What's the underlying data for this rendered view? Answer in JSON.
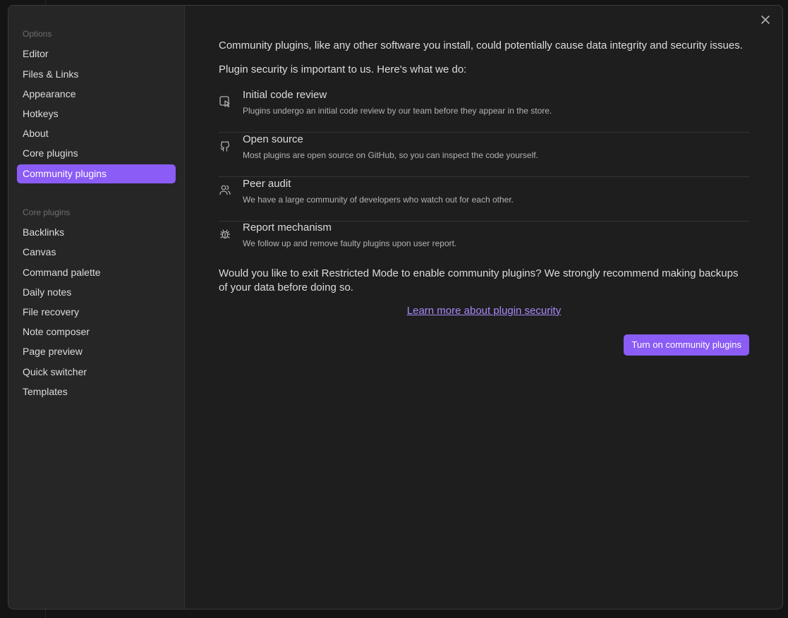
{
  "sidebar": {
    "options_heading": "Options",
    "options_items": [
      {
        "label": "Editor"
      },
      {
        "label": "Files & Links"
      },
      {
        "label": "Appearance"
      },
      {
        "label": "Hotkeys"
      },
      {
        "label": "About"
      },
      {
        "label": "Core plugins"
      },
      {
        "label": "Community plugins",
        "active": true
      }
    ],
    "core_heading": "Core plugins",
    "core_items": [
      {
        "label": "Backlinks"
      },
      {
        "label": "Canvas"
      },
      {
        "label": "Command palette"
      },
      {
        "label": "Daily notes"
      },
      {
        "label": "File recovery"
      },
      {
        "label": "Note composer"
      },
      {
        "label": "Page preview"
      },
      {
        "label": "Quick switcher"
      },
      {
        "label": "Templates"
      }
    ]
  },
  "main": {
    "warning": "Community plugins, like any other software you install, could potentially cause data integrity and security issues.",
    "security_intro": "Plugin security is important to us. Here's what we do:",
    "features": [
      {
        "icon": "code-review-icon",
        "title": "Initial code review",
        "description": "Plugins undergo an initial code review by our team before they appear in the store."
      },
      {
        "icon": "github-icon",
        "title": "Open source",
        "description": "Most plugins are open source on GitHub, so you can inspect the code yourself."
      },
      {
        "icon": "users-icon",
        "title": "Peer audit",
        "description": "We have a large community of developers who watch out for each other."
      },
      {
        "icon": "bug-icon",
        "title": "Report mechanism",
        "description": "We follow up and remove faulty plugins upon user report."
      }
    ],
    "question": "Would you like to exit Restricted Mode to enable community plugins? We strongly recommend making backups of your data before doing so.",
    "learn_more_link": "Learn more about plugin security",
    "turn_on_button": "Turn on community plugins"
  },
  "colors": {
    "accent": "#8b5cf6",
    "link": "#a68af9",
    "background": "#1e1e1e",
    "sidebar_background": "#262626",
    "text": "#dcdcdc"
  }
}
